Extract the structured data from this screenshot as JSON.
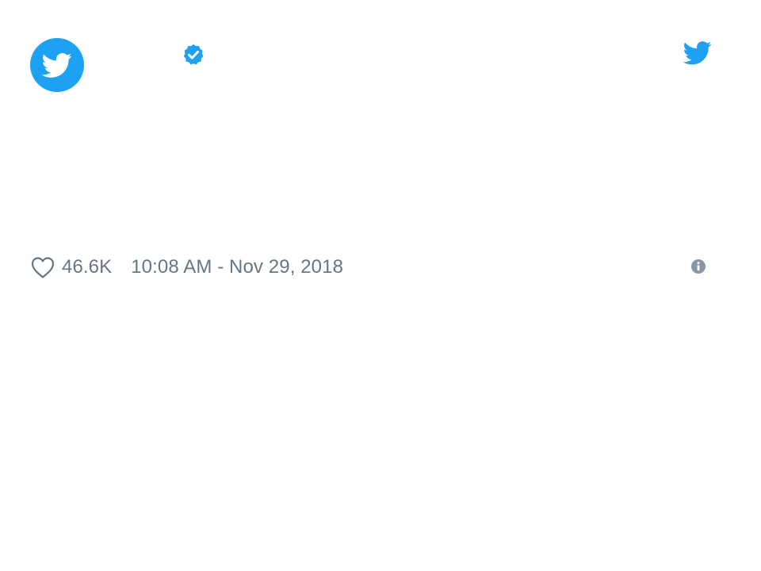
{
  "tweet": {
    "like_count": "46.6K",
    "timestamp": "10:08 AM - Nov 29, 2018"
  },
  "icons": {
    "avatar": "twitter-bird-icon",
    "verified": "verified-badge-icon",
    "brand": "twitter-logo-icon",
    "like": "heart-outline-icon",
    "info": "info-circle-icon"
  },
  "colors": {
    "brand_blue": "#1da1f2",
    "meta_text": "#657786",
    "info_icon": "#8899a6"
  }
}
